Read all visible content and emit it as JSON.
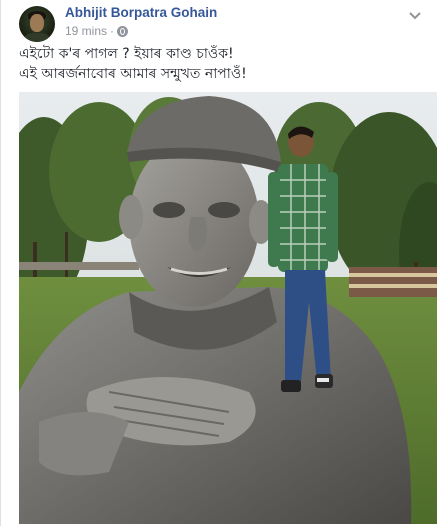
{
  "post": {
    "author": "Abhijit Borpatra Gohain",
    "timestamp": "19 mins",
    "separator": "·",
    "privacy_icon": "globe-icon",
    "menu_icon": "chevron-down-icon",
    "text_lines": [
      "এইটো ক'ৰ পাগল ? ইয়াৰ কাণ্ড চাওঁক!",
      "এই আৰৰ্জনাবোৰ আমাৰ সন্মুখত নাপাওঁ!"
    ],
    "photo": {
      "description_icon": "statue-photo"
    }
  },
  "colors": {
    "author_link": "#365899",
    "meta_text": "#90949c",
    "body_text": "#1d2129",
    "page_bg": "#ffffff"
  }
}
